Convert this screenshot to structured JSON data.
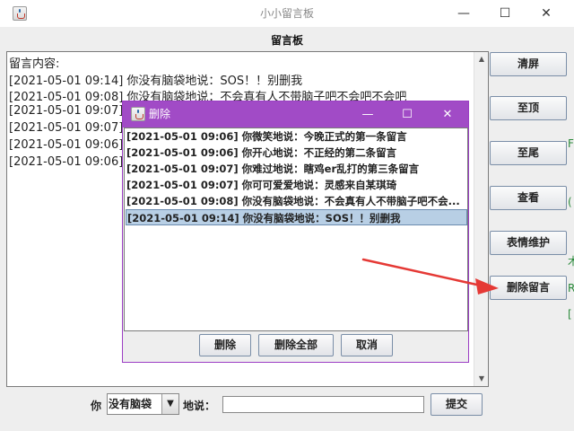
{
  "window": {
    "title": "小小留言板",
    "minimize": "—",
    "maximize": "☐",
    "close": "✕"
  },
  "board_label": "留言板",
  "messages": {
    "header": "留言内容:",
    "lines": [
      "[2021-05-01 09:14] 你没有脑袋地说：SOS！！别删我",
      "[2021-05-01 09:08] 你没有脑袋地说：不会真有人不带脑子吧不会吧不会吧",
      "[2021-05-01 09:07]",
      "[2021-05-01 09:07]",
      "[2021-05-01 09:06]",
      "[2021-05-01 09:06]"
    ]
  },
  "side_buttons": [
    "清屏",
    "至顶",
    "至尾",
    "查看",
    "表情维护",
    "删除留言"
  ],
  "edge_chars": [
    "F",
    "(",
    "木",
    "R",
    "[",
    "r"
  ],
  "bottom": {
    "you_label": "你",
    "mood_value": "没有脑袋",
    "say_label": "地说：",
    "input_value": "",
    "submit_label": "提交"
  },
  "dialog": {
    "title": "删除",
    "minimize": "—",
    "maximize": "☐",
    "close": "✕",
    "entries": [
      "[2021-05-01 09:06] 你微笑地说：今晚正式的第一条留言",
      "[2021-05-01 09:06] 你开心地说：不正经的第二条留言",
      "[2021-05-01 09:07] 你难过地说：瞎鸡er乱打的第三条留言",
      "[2021-05-01 09:07] 你可可爱爱地说：灵感来自某琪琦",
      "[2021-05-01 09:08] 你没有脑袋地说：不会真有人不带脑子吧不会...",
      "[2021-05-01 09:14] 你没有脑袋地说：SOS！！别删我"
    ],
    "selected_index": 5,
    "buttons": [
      "删除",
      "删除全部",
      "取消"
    ]
  },
  "colors": {
    "dialog_title": "#a14bc6",
    "selection": "#b8cfe5",
    "annotation_arrow": "#e53935"
  }
}
